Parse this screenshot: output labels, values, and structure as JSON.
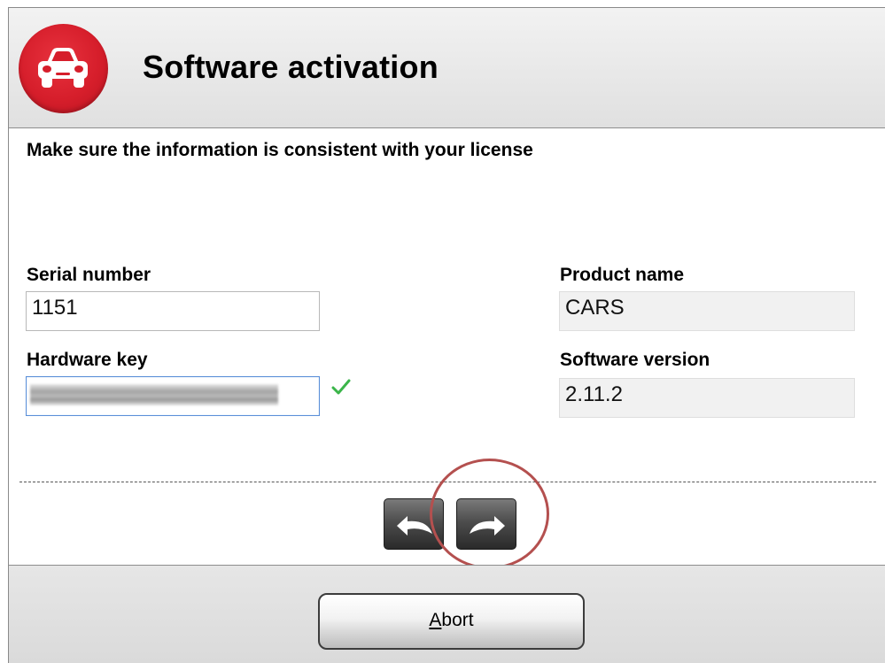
{
  "window": {
    "title": "Software activation",
    "logo_icon": "car-icon",
    "accent_color": "#d61e2b"
  },
  "main": {
    "instruction": "Make sure the information is consistent with your license",
    "serial_number": {
      "label": "Serial number",
      "value": "1151"
    },
    "hardware_key": {
      "label": "Hardware key",
      "value": "",
      "status_icon": "checkmark-icon"
    },
    "product_name": {
      "label": "Product name",
      "value": "CARS"
    },
    "software_version": {
      "label": "Software version",
      "value": "2.11.2"
    }
  },
  "navigation": {
    "back_icon": "back-arrow-icon",
    "next_icon": "next-arrow-icon"
  },
  "footer": {
    "abort_label_mnemonic": "A",
    "abort_label_rest": "bort"
  }
}
